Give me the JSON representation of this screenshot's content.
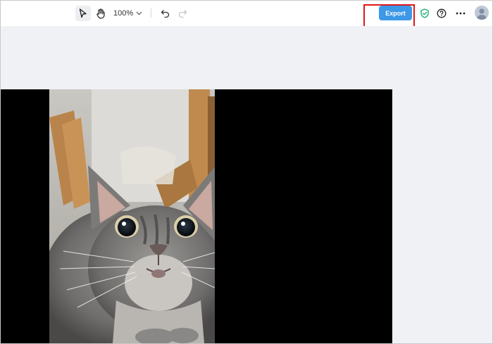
{
  "toolbar": {
    "zoom_level": "100%",
    "export_label": "Export",
    "icons": {
      "select": "cursor-arrow-icon",
      "hand": "hand-icon",
      "zoom_dropdown": "chevron-down-icon",
      "undo": "undo-icon",
      "redo": "redo-icon",
      "shield": "shield-check-icon",
      "help": "help-circle-icon",
      "more": "more-dots-icon",
      "avatar": "user-avatar-icon"
    }
  },
  "canvas": {
    "media": "video-frame-cat"
  },
  "colors": {
    "accent": "#3e98e8",
    "highlight": "#e0171c",
    "shield": "#1aaa74",
    "canvas_bg": "#eff1f5",
    "toolbar_bg": "#ffffff"
  }
}
